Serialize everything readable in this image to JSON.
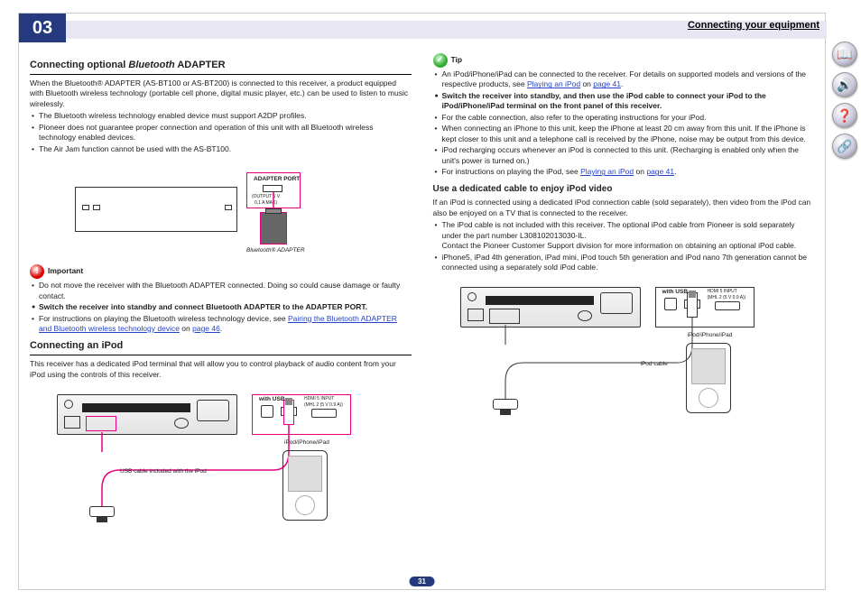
{
  "header": {
    "chapter": "03",
    "breadcrumb": "Connecting your equipment"
  },
  "page_number": "31",
  "left": {
    "h1_pre": "Connecting optional ",
    "h1_em": "Bluetooth",
    "h1_post": " ADAPTER",
    "intro1": "When the Bluetooth® ADAPTER (AS-BT100 or AS-BT200) is connected to this receiver, a product equipped with Bluetooth wireless technology (portable cell phone, digital music player, etc.) can be used to listen to music wirelessly.",
    "b1": "The Bluetooth wireless technology enabled device must support A2DP profiles.",
    "b2": "Pioneer does not guarantee proper connection and operation of this unit with all Bluetooth wireless technology enabled devices.",
    "b3": "The Air Jam function cannot be used with the AS-BT100.",
    "adapter_port": "ADAPTER PORT",
    "adapter_sub": "(OUTPUT 5 V\n0.1 A MAX)",
    "adapter_caption": "Bluetooth® ADAPTER",
    "important_label": "Important",
    "imp1": "Do not move the receiver with the Bluetooth ADAPTER connected. Doing so could cause damage or faulty contact.",
    "imp_bold": "Switch the receiver into standby and connect Bluetooth ADAPTER to the ADAPTER PORT.",
    "imp2_pre": "For instructions on playing the Bluetooth wireless technology device, see ",
    "imp2_link": "Pairing the Bluetooth ADAPTER and Bluetooth wireless technology device",
    "imp2_mid": " on ",
    "imp2_page": "page 46",
    "imp2_post": ".",
    "h2": "Connecting an iPod",
    "ipod_intro": "This receiver has a dedicated iPod terminal that will allow you to control playback of audio content from your iPod using the controls of this receiver.",
    "ipod_label": "iPod/iPhone/iPad",
    "usb_caption": "USB cable included with the iPod",
    "usb_small": "with USB",
    "hdmi_small": "HDMI 5 INPUT\n(MHL 2 (5 V 0.9 A))"
  },
  "right": {
    "tip_label": "Tip",
    "tip1_pre": "An iPod/iPhone/iPad can be connected to the receiver. For details on supported models and versions of the respective products, see ",
    "tip1_link": "Playing an iPod",
    "tip1_mid": " on ",
    "tip1_page": "page 41",
    "tip1_post": ".",
    "bold1": "Switch the receiver into standby, and then use the iPod cable to connect your iPod to the iPod/iPhone/iPad terminal on the front panel of this receiver.",
    "r1": "For the cable connection, also refer to the operating instructions for your iPod.",
    "r2": "When connecting an iPhone to this unit, keep the iPhone at least 20 cm away from this unit. If the iPhone is kept closer to this unit and a telephone call is received by the iPhone, noise may be output from this device.",
    "r3": "iPod recharging occurs whenever an iPod is connected to this unit. (Recharging is enabled only when the unit's power is turned on.)",
    "r4_pre": "For instructions on playing the iPod, see ",
    "r4_link": "Playing an iPod",
    "r4_mid": " on ",
    "r4_page": "page 41",
    "r4_post": ".",
    "h3": "Use a dedicated cable to enjoy iPod video",
    "v_intro": "If an iPod is connected using a dedicated iPod connection cable (sold separately), then video from the iPod can also be enjoyed on a TV that is connected to the receiver.",
    "v1": "The iPod cable is not included with this receiver. The optional iPod cable from Pioneer is sold separately under the part number L308102013030-IL.",
    "v1b": "Contact the Pioneer Customer Support division for more information on obtaining an optional iPod cable.",
    "v2": "iPhone5, iPad 4th generation, iPad mini, iPod touch 5th generation and iPod nano 7th generation cannot be connected using a separately sold iPod cable.",
    "ipod_label2": "iPod/iPhone/iPad",
    "ipod_cable": "iPod cable"
  },
  "sidebar": [
    {
      "name": "book-icon",
      "glyph": "📖"
    },
    {
      "name": "speaker-icon",
      "glyph": "🔊"
    },
    {
      "name": "help-icon",
      "glyph": "❓"
    },
    {
      "name": "network-icon",
      "glyph": "🔗"
    }
  ]
}
